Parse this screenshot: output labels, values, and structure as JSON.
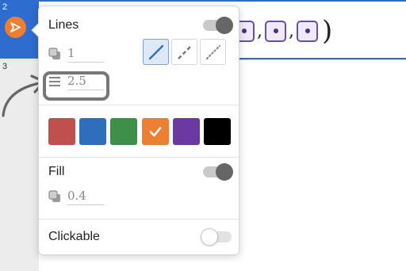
{
  "expression_list": {
    "rows": [
      {
        "number": "2"
      },
      {
        "number": "3"
      }
    ],
    "point_list": {
      "open": "",
      "separator": ",",
      "close": ")"
    }
  },
  "style_menu": {
    "lines": {
      "label": "Lines",
      "toggle_on": true,
      "opacity_value": "1",
      "width_value": "2.5",
      "styles": [
        "solid",
        "dashed",
        "dotted"
      ],
      "selected_style": "solid"
    },
    "colors": {
      "swatches": [
        "#c0504d",
        "#2f6ebd",
        "#3f8f4a",
        "#ec7f32",
        "#6a3aa2",
        "#000000"
      ],
      "selected_index": 3
    },
    "fill": {
      "label": "Fill",
      "toggle_on": true,
      "opacity_value": "0.4"
    },
    "clickable": {
      "label": "Clickable",
      "toggle_on": false
    }
  },
  "colors": {
    "accent_blue": "#2f6ccf",
    "highlight_gray": "#777777",
    "point_purple": "#6b4fa5"
  }
}
